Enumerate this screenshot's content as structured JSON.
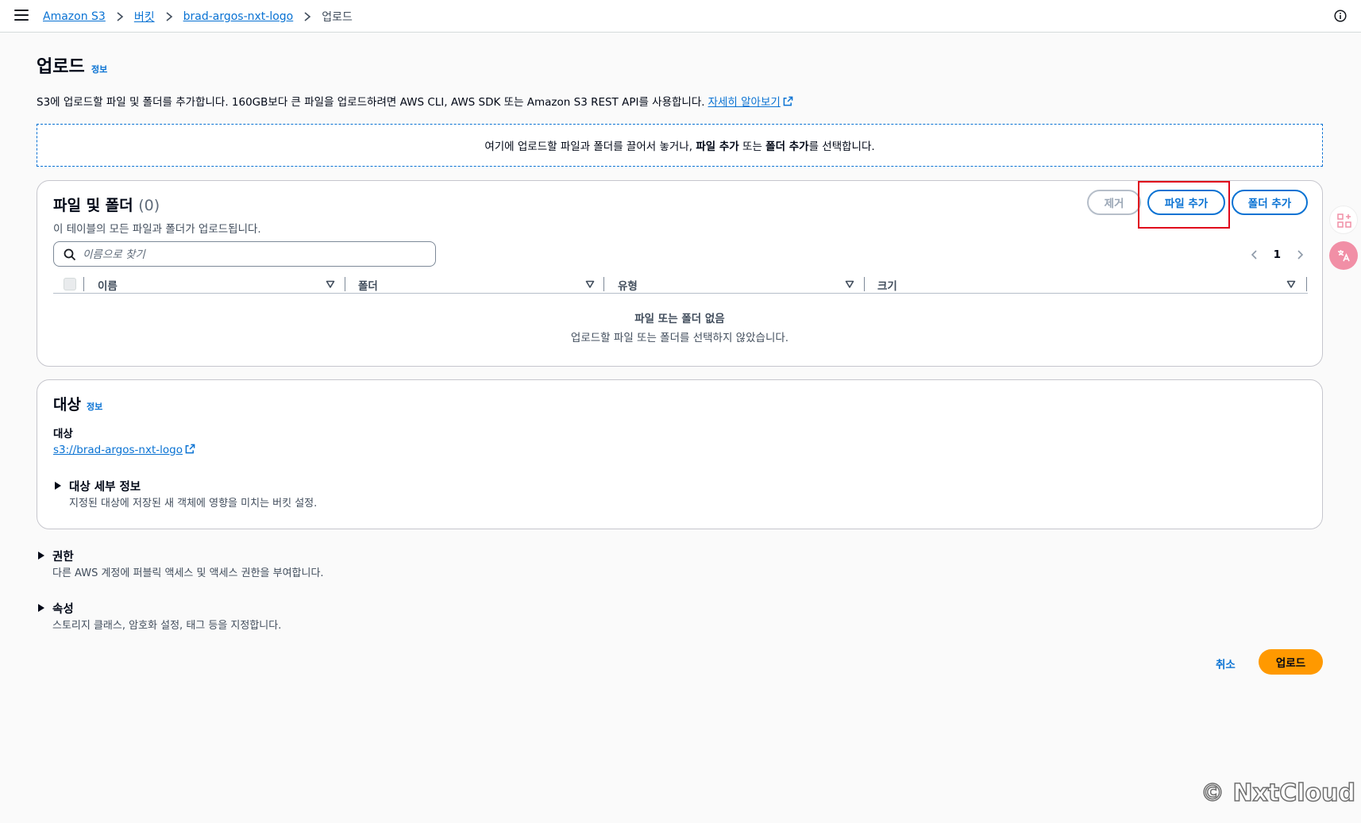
{
  "breadcrumb": {
    "items": [
      "Amazon S3",
      "버킷",
      "brad-argos-nxt-logo"
    ],
    "current": "업로드"
  },
  "page": {
    "title": "업로드",
    "info_label": "정보",
    "description": "S3에 업로드할 파일 및 폴더를 추가합니다. 160GB보다 큰 파일을 업로드하려면 AWS CLI, AWS SDK 또는 Amazon S3 REST API를 사용합니다.",
    "learn_more": "자세히 알아보기"
  },
  "dropzone": {
    "prefix": "여기에 업로드할 파일과 폴더를 끌어서 놓거나,",
    "add_files": "파일 추가",
    "middle": "또는",
    "add_folder": "폴더 추가",
    "suffix": "를 선택합니다."
  },
  "files_section": {
    "title": "파일 및 폴더",
    "count": "(0)",
    "subtitle": "이 테이블의 모든 파일과 폴더가 업로드됩니다.",
    "remove_button": "제거",
    "add_files_button": "파일 추가",
    "add_folder_button": "폴더 추가",
    "search_placeholder": "이름으로 찾기",
    "current_page": "1",
    "columns": [
      "이름",
      "폴더",
      "유형",
      "크기"
    ],
    "empty_title": "파일 또는 폴더 없음",
    "empty_subtitle": "업로드할 파일 또는 폴더를 선택하지 않았습니다."
  },
  "destination_section": {
    "title": "대상",
    "info_label": "정보",
    "field_label": "대상",
    "destination_url": "s3://brad-argos-nxt-logo",
    "details_title": "대상 세부 정보",
    "details_subtitle": "지정된 대상에 저장된 새 객체에 영향을 미치는 버킷 설정."
  },
  "permissions": {
    "title": "권한",
    "subtitle": "다른 AWS 계정에 퍼블릭 액세스 및 액세스 권한을 부여합니다."
  },
  "properties": {
    "title": "속성",
    "subtitle": "스토리지 클래스, 암호화 설정, 태그 등을 지정합니다."
  },
  "footer": {
    "cancel": "취소",
    "upload": "업로드"
  },
  "watermark": "© NxtCloud",
  "colors": {
    "link": "#0972d3",
    "primary": "#ff9900",
    "highlight": "#e0001b"
  }
}
